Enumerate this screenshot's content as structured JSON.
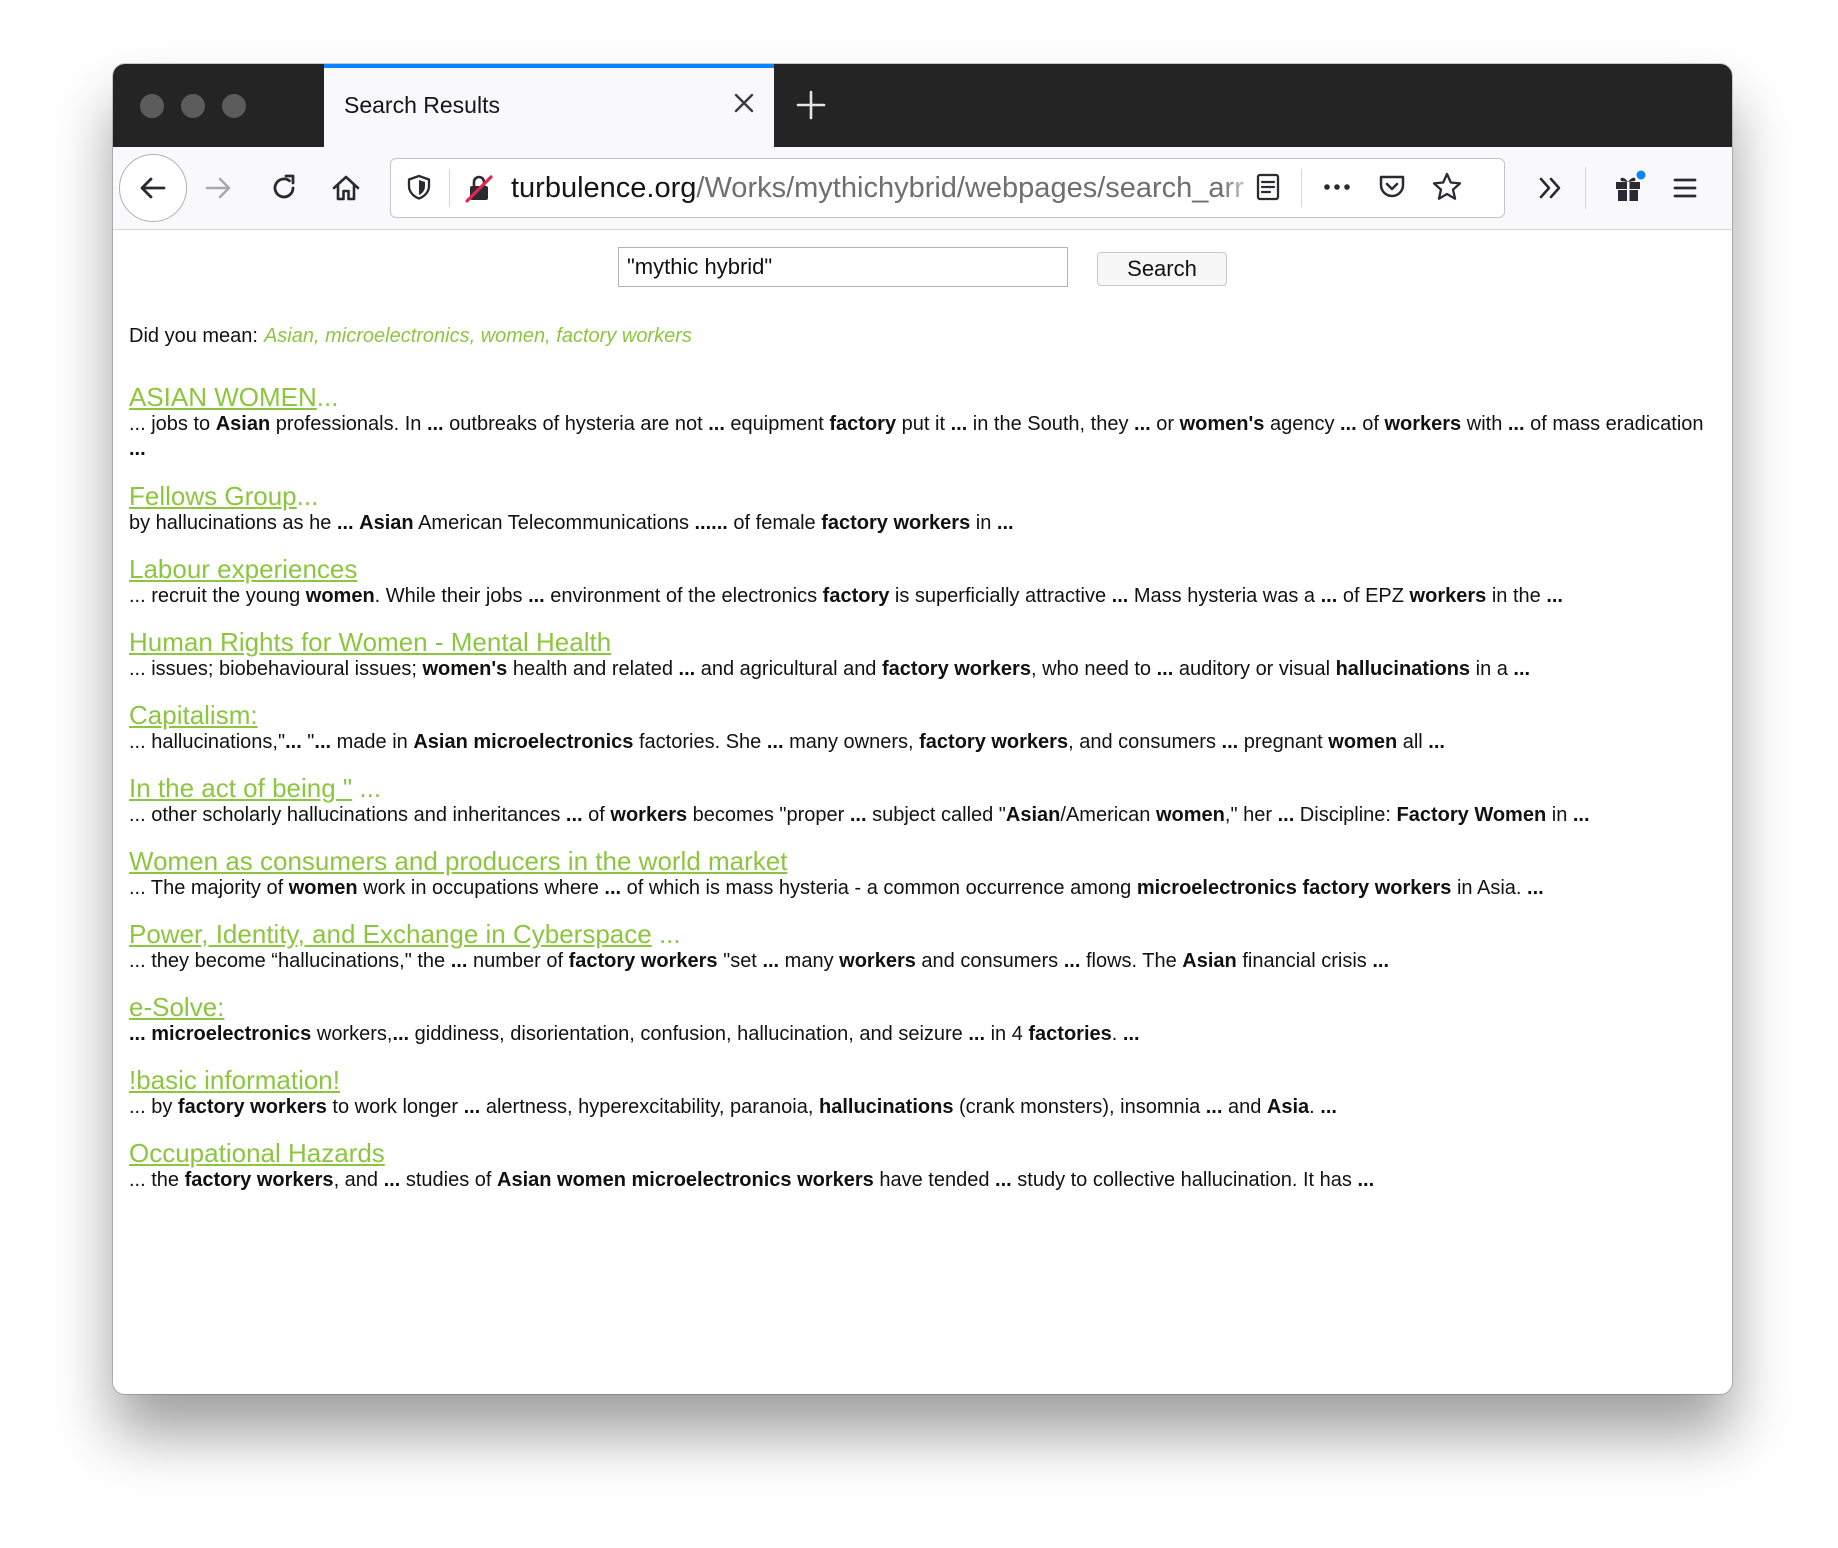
{
  "tab": {
    "title": "Search Results"
  },
  "url": {
    "host": "turbulence.org",
    "path": "/Works/mythichybrid/webpages/search_arr"
  },
  "search": {
    "value": "\"mythic hybrid\"",
    "button_label": "Search"
  },
  "did_you_mean": {
    "label": "Did you mean:",
    "suggestion": "Asian, microelectronics, women, factory workers"
  },
  "colors": {
    "link": "#8cc63f",
    "tab_accent": "#0a84ff",
    "titlebar": "#242424"
  },
  "results": [
    {
      "title": "ASIAN WOMEN",
      "title_suffix": "...",
      "snippet": [
        {
          "t": "... jobs to ",
          "b": false
        },
        {
          "t": "Asian",
          "b": true
        },
        {
          "t": " professionals. In ",
          "b": false
        },
        {
          "t": "...",
          "b": true
        },
        {
          "t": " outbreaks of hysteria are not ",
          "b": false
        },
        {
          "t": "...",
          "b": true
        },
        {
          "t": " equipment ",
          "b": false
        },
        {
          "t": "factory",
          "b": true
        },
        {
          "t": " put it ",
          "b": false
        },
        {
          "t": "...",
          "b": true
        },
        {
          "t": " in the South, they ",
          "b": false
        },
        {
          "t": "...",
          "b": true
        },
        {
          "t": " or ",
          "b": false
        },
        {
          "t": "women's",
          "b": true
        },
        {
          "t": " agency ",
          "b": false
        },
        {
          "t": "...",
          "b": true
        },
        {
          "t": " of ",
          "b": false
        },
        {
          "t": "workers",
          "b": true
        },
        {
          "t": " with ",
          "b": false
        },
        {
          "t": "...",
          "b": true
        },
        {
          "t": " of mass eradication ",
          "b": false
        },
        {
          "t": "...",
          "b": true
        }
      ]
    },
    {
      "title": "Fellows Group",
      "title_suffix": "...",
      "snippet": [
        {
          "t": "by hallucinations as he ",
          "b": false
        },
        {
          "t": "...",
          "b": true
        },
        {
          "t": " ",
          "b": false
        },
        {
          "t": "Asian",
          "b": true
        },
        {
          "t": " American Telecommunications ",
          "b": false
        },
        {
          "t": "......",
          "b": true
        },
        {
          "t": " of female ",
          "b": false
        },
        {
          "t": "factory workers",
          "b": true
        },
        {
          "t": " in ",
          "b": false
        },
        {
          "t": "...",
          "b": true
        }
      ]
    },
    {
      "title": "Labour experiences",
      "title_suffix": "",
      "snippet": [
        {
          "t": "... recruit the young ",
          "b": false
        },
        {
          "t": "women",
          "b": true
        },
        {
          "t": ". While their jobs ",
          "b": false
        },
        {
          "t": "...",
          "b": true
        },
        {
          "t": " environment of the electronics ",
          "b": false
        },
        {
          "t": "factory",
          "b": true
        },
        {
          "t": " is superficially attractive ",
          "b": false
        },
        {
          "t": "...",
          "b": true
        },
        {
          "t": " Mass hysteria was a ",
          "b": false
        },
        {
          "t": "...",
          "b": true
        },
        {
          "t": " of EPZ ",
          "b": false
        },
        {
          "t": "workers",
          "b": true
        },
        {
          "t": " in the ",
          "b": false
        },
        {
          "t": "...",
          "b": true
        }
      ]
    },
    {
      "title": "Human Rights for Women - Mental Health",
      "title_suffix": "",
      "snippet": [
        {
          "t": "... issues; biobehavioural issues; ",
          "b": false
        },
        {
          "t": "women's",
          "b": true
        },
        {
          "t": " health and related ",
          "b": false
        },
        {
          "t": "...",
          "b": true
        },
        {
          "t": " and agricultural and ",
          "b": false
        },
        {
          "t": "factory workers",
          "b": true
        },
        {
          "t": ", who need to ",
          "b": false
        },
        {
          "t": "...",
          "b": true
        },
        {
          "t": " auditory or visual ",
          "b": false
        },
        {
          "t": "hallucinations",
          "b": true
        },
        {
          "t": " in a ",
          "b": false
        },
        {
          "t": "...",
          "b": true
        }
      ]
    },
    {
      "title": "Capitalism:",
      "title_suffix": "",
      "snippet": [
        {
          "t": "... hallucinations,\"",
          "b": false
        },
        {
          "t": "...",
          "b": true
        },
        {
          "t": " \"",
          "b": false
        },
        {
          "t": "...",
          "b": true
        },
        {
          "t": " made in ",
          "b": false
        },
        {
          "t": "Asian microelectronics",
          "b": true
        },
        {
          "t": " factories. She ",
          "b": false
        },
        {
          "t": "...",
          "b": true
        },
        {
          "t": " many owners, ",
          "b": false
        },
        {
          "t": "factory workers",
          "b": true
        },
        {
          "t": ", and consumers ",
          "b": false
        },
        {
          "t": "...",
          "b": true
        },
        {
          "t": " pregnant ",
          "b": false
        },
        {
          "t": "women",
          "b": true
        },
        {
          "t": " all ",
          "b": false
        },
        {
          "t": "...",
          "b": true
        }
      ]
    },
    {
      "title": "In the act of being \"",
      "title_suffix": " ...",
      "snippet": [
        {
          "t": "... other scholarly hallucinations and inheritances ",
          "b": false
        },
        {
          "t": "...",
          "b": true
        },
        {
          "t": " of ",
          "b": false
        },
        {
          "t": "workers",
          "b": true
        },
        {
          "t": " becomes \"proper ",
          "b": false
        },
        {
          "t": "...",
          "b": true
        },
        {
          "t": " subject called \"",
          "b": false
        },
        {
          "t": "Asian",
          "b": true
        },
        {
          "t": "/American ",
          "b": false
        },
        {
          "t": "women",
          "b": true
        },
        {
          "t": ",\" her ",
          "b": false
        },
        {
          "t": "...",
          "b": true
        },
        {
          "t": " Discipline: ",
          "b": false
        },
        {
          "t": "Factory Women",
          "b": true
        },
        {
          "t": " in ",
          "b": false
        },
        {
          "t": "...",
          "b": true
        }
      ]
    },
    {
      "title": "Women as consumers and producers in the world market",
      "title_suffix": "",
      "snippet": [
        {
          "t": "... The majority of ",
          "b": false
        },
        {
          "t": "women",
          "b": true
        },
        {
          "t": " work in occupations where ",
          "b": false
        },
        {
          "t": "...",
          "b": true
        },
        {
          "t": " of which is mass hysteria - a common occurrence among ",
          "b": false
        },
        {
          "t": "microelectronics factory workers",
          "b": true
        },
        {
          "t": " in Asia. ",
          "b": false
        },
        {
          "t": "...",
          "b": true
        }
      ]
    },
    {
      "title": "Power, Identity, and Exchange in Cyberspace",
      "title_suffix": " ...",
      "snippet": [
        {
          "t": "... they become “hallucinations,\" the ",
          "b": false
        },
        {
          "t": "...",
          "b": true
        },
        {
          "t": " number of ",
          "b": false
        },
        {
          "t": "factory workers",
          "b": true
        },
        {
          "t": " \"set ",
          "b": false
        },
        {
          "t": "...",
          "b": true
        },
        {
          "t": " many ",
          "b": false
        },
        {
          "t": "workers",
          "b": true
        },
        {
          "t": " and consumers ",
          "b": false
        },
        {
          "t": "...",
          "b": true
        },
        {
          "t": " flows. The ",
          "b": false
        },
        {
          "t": "Asian",
          "b": true
        },
        {
          "t": " financial crisis ",
          "b": false
        },
        {
          "t": "...",
          "b": true
        }
      ]
    },
    {
      "title": "e-Solve:",
      "title_suffix": "",
      "snippet": [
        {
          "t": "... ",
          "b": true
        },
        {
          "t": "microelectronics",
          "b": true
        },
        {
          "t": " workers,",
          "b": false
        },
        {
          "t": "...",
          "b": true
        },
        {
          "t": " giddiness, disorientation, confusion, hallucination, and seizure ",
          "b": false
        },
        {
          "t": "...",
          "b": true
        },
        {
          "t": " in 4 ",
          "b": false
        },
        {
          "t": "factories",
          "b": true
        },
        {
          "t": ". ",
          "b": false
        },
        {
          "t": "...",
          "b": true
        }
      ]
    },
    {
      "title": "!basic information!",
      "title_suffix": "",
      "snippet": [
        {
          "t": "... by ",
          "b": false
        },
        {
          "t": "factory workers",
          "b": true
        },
        {
          "t": " to work longer ",
          "b": false
        },
        {
          "t": "...",
          "b": true
        },
        {
          "t": " alertness, hyperexcitability, paranoia, ",
          "b": false
        },
        {
          "t": "hallucinations",
          "b": true
        },
        {
          "t": " (crank monsters), insomnia ",
          "b": false
        },
        {
          "t": "...",
          "b": true
        },
        {
          "t": " and ",
          "b": false
        },
        {
          "t": "Asia",
          "b": true
        },
        {
          "t": ". ",
          "b": false
        },
        {
          "t": "...",
          "b": true
        }
      ]
    },
    {
      "title": "Occupational Hazards",
      "title_suffix": "",
      "snippet": [
        {
          "t": "... the ",
          "b": false
        },
        {
          "t": "factory workers",
          "b": true
        },
        {
          "t": ", and ",
          "b": false
        },
        {
          "t": "...",
          "b": true
        },
        {
          "t": " studies of ",
          "b": false
        },
        {
          "t": "Asian women microelectronics workers",
          "b": true
        },
        {
          "t": " have tended ",
          "b": false
        },
        {
          "t": "...",
          "b": true
        },
        {
          "t": " study to collective hallucination. It has ",
          "b": false
        },
        {
          "t": "...",
          "b": true
        }
      ]
    }
  ]
}
